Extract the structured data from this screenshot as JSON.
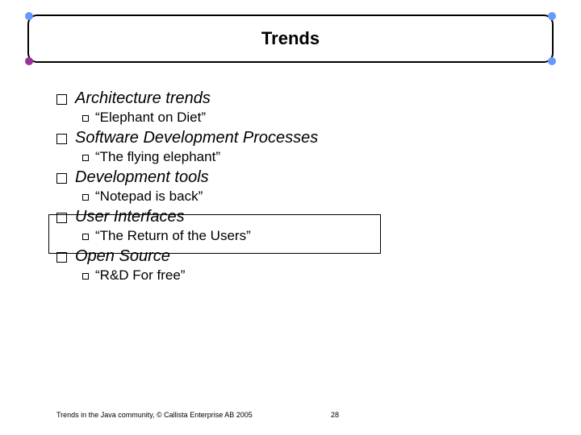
{
  "title": "Trends",
  "items": [
    {
      "main": "Architecture trends",
      "sub": "“Elephant on Diet”"
    },
    {
      "main": "Software Development Processes",
      "sub": "“The flying elephant”"
    },
    {
      "main": "Development tools",
      "sub": "“Notepad is back”"
    },
    {
      "main": "User Interfaces",
      "sub": "“The Return of the Users”"
    },
    {
      "main": "Open Source",
      "sub": "“R&D For free”"
    }
  ],
  "footer": "Trends in the Java community, © Callista Enterprise AB 2005",
  "page": "28"
}
